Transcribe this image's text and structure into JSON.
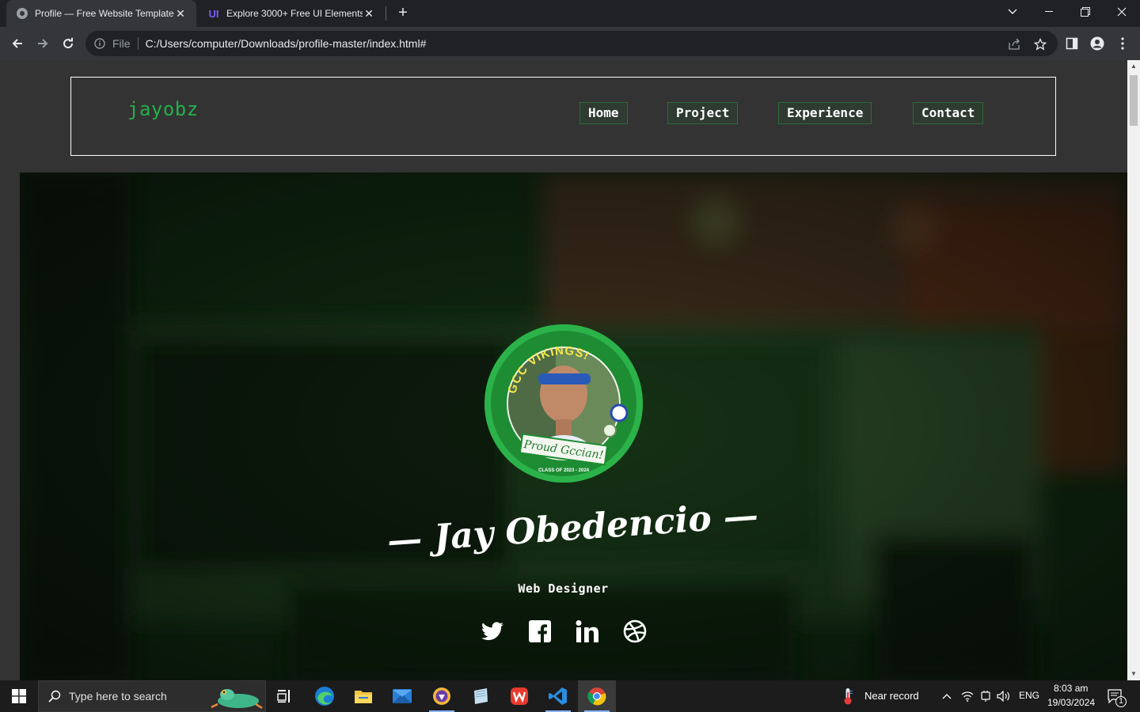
{
  "browser": {
    "tabs": [
      {
        "title": "Profile — Free Website Template",
        "active": true
      },
      {
        "title": "Explore 3000+ Free UI Elements",
        "active": false,
        "favicon_text": "UI"
      }
    ],
    "omnibox": {
      "scheme_label": "File",
      "url": "C:/Users/computer/Downloads/profile-master/index.html#"
    }
  },
  "site": {
    "logo": "jayobz",
    "nav": [
      "Home",
      "Project",
      "Experience",
      "Contact"
    ],
    "hero": {
      "name": "— Jay Obedencio —",
      "role": "Web Designer",
      "avatar_badge_top": "GCC VIKINGS!",
      "avatar_badge_bottom": "Proud Gccian!",
      "avatar_badge_class": "CLASS OF 2023 - 2024",
      "social": [
        "twitter-icon",
        "facebook-icon",
        "linkedin-icon",
        "dribbble-icon"
      ]
    }
  },
  "taskbar": {
    "search_placeholder": "Type here to search",
    "weather": "Near record",
    "language": "ENG",
    "time": "8:03 am",
    "date": "19/03/2024",
    "notification_count": "1"
  },
  "colors": {
    "accent_green": "#22b04a",
    "page_bg": "#333333",
    "hero_tint": "#0c1f0c"
  }
}
